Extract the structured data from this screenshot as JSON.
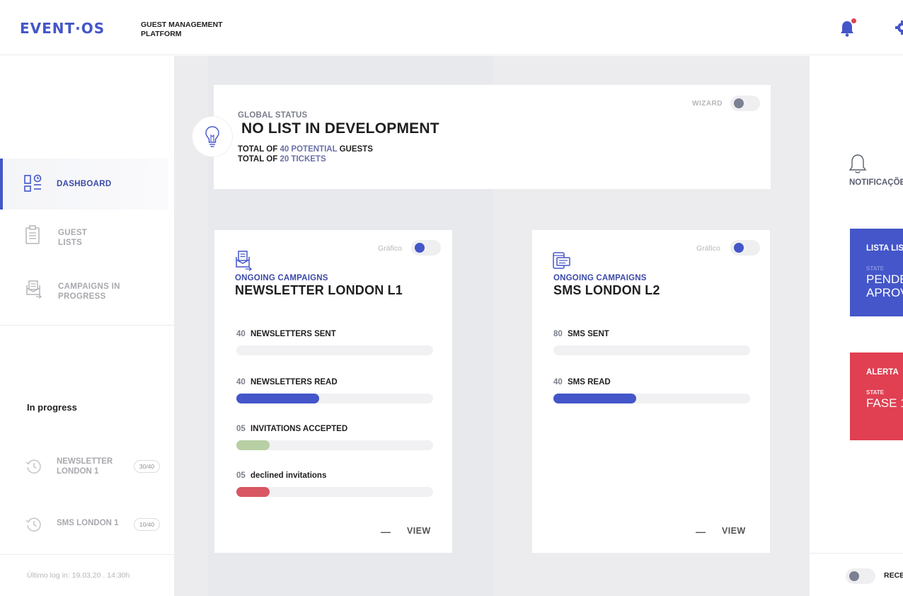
{
  "header": {
    "logo": "EVENT·OS",
    "platform_title": "GUEST MANAGEMENT PLATFORM"
  },
  "sidebar": {
    "items": [
      {
        "label": "DASHBOARD",
        "icon": "dashboard-icon",
        "active": true
      },
      {
        "label": "GUEST LISTS",
        "icon": "clipboard-icon",
        "active": false
      },
      {
        "label": "CAMPAIGNS IN PROGRESS",
        "icon": "campaign-icon",
        "active": false
      }
    ],
    "in_progress_title": "In progress",
    "in_progress": [
      {
        "label": "NEWSLETTER LONDON 1",
        "badge": "30/40"
      },
      {
        "label": "SMS LONDON 1",
        "badge": "10/40"
      }
    ],
    "last_login": "Último log in: 19.03.20  .  14:30h"
  },
  "status": {
    "subtitle": "GLOBAL STATUS",
    "title": "NO LIST IN DEVELOPMENT",
    "line1_prefix": "TOTAL OF",
    "line1_highlight": "40 POTENTIAL",
    "line1_suffix": "GUESTS",
    "line2_prefix": "TOTAL OF",
    "line2_highlight": "20 TICKETS",
    "wizard_label": "WIZARD",
    "wizard_on": false
  },
  "campaigns": [
    {
      "graph_label": "Gráfico",
      "graph_on": true,
      "subtitle": "ONGOING CAMPAIGNS",
      "title": "NEWSLETTER LONDON L1",
      "icon": "newsletter-icon",
      "metrics": [
        {
          "num": "40",
          "label": "NEWSLETTERS SENT",
          "fill": 0,
          "color": "#4456c9"
        },
        {
          "num": "40",
          "label": "NEWSLETTERS READ",
          "fill": 0.42,
          "color": "#4456c9"
        },
        {
          "num": "05",
          "label": "INVITATIONS ACCEPTED",
          "fill": 0.17,
          "color": "#b7cfa3"
        },
        {
          "num": "05",
          "label": "declined invitations",
          "fill": 0.17,
          "color": "#d95663"
        }
      ],
      "dash": "—",
      "view": "VIEW"
    },
    {
      "graph_label": "Gráfico",
      "graph_on": true,
      "subtitle": "ONGOING CAMPAIGNS",
      "title": "SMS LONDON L2",
      "icon": "sms-icon",
      "metrics": [
        {
          "num": "80",
          "label": "SMS SENT",
          "fill": 0,
          "color": "#4456c9"
        },
        {
          "num": "40",
          "label": "SMS READ",
          "fill": 0.42,
          "color": "#4456c9"
        }
      ],
      "dash": "—",
      "view": "VIEW"
    }
  ],
  "right_panel": {
    "notifications_label": "NOTIFICAÇÕES",
    "cards": [
      {
        "title": "LISTA LIS",
        "sub": "STATE",
        "big1": "PENDE",
        "big2": "APROV",
        "color": "#4456c9"
      },
      {
        "title": "ALERTA",
        "sub": "STATE",
        "big1": "FASE 1",
        "big2": "",
        "color": "#e04052"
      }
    ],
    "bottom_label": "RECE"
  }
}
